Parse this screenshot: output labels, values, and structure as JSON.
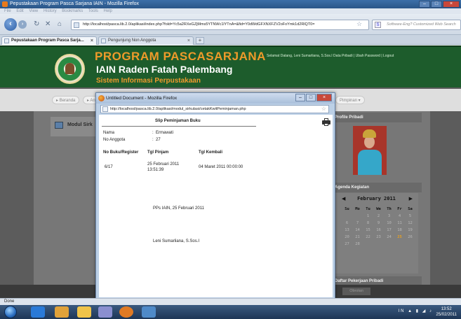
{
  "browser": {
    "window_title": "Pepustakaan Program Pasca Sarjana IAIN - Mozilla Firefox",
    "menu": [
      "File",
      "Edit",
      "View",
      "History",
      "Bookmarks",
      "Tools",
      "Help"
    ],
    "url": "http://localhost/pasca.lib.2.0/aplikasi/index.php?fold=Yc5a2RXeGZjMms5YTNWc1lYTnA=&fid=Y0dWdGFXNXFZV2oFoYmk1d2RlQT0=",
    "search_placeholder": "Software-Eng? Customized Web Search",
    "tabs": [
      {
        "label": "Pepustakaan Program Pasca Sarja..."
      },
      {
        "label": "Pengunjung Non Anggota"
      }
    ],
    "status": "Done"
  },
  "site": {
    "title": "PROGRAM PASCASARJANA",
    "subtitle": "IAIN Raden Fatah Palembang",
    "tagline": "Sistem Informasi Perpustakaan",
    "welcome": "Selamat Datang, Leni Sumarliana, S.Sos.I   Data Pribadi | Ubah Password | Logout",
    "menu": {
      "home": "Beranda",
      "partial": "An",
      "leader": "Pimpinan"
    },
    "module_label": "Modul Sirk",
    "side_profile": "Profile Pribadi",
    "side_agenda": "Agenda Kegiatan",
    "side_tasks": "Daftar Pekerjaan Pribadi",
    "footer_btn": "Obrolan"
  },
  "calendar": {
    "title": "February 2011",
    "weekdays": [
      "Su",
      "Mo",
      "Tu",
      "We",
      "Th",
      "Fr",
      "Sa"
    ],
    "days": [
      "",
      "",
      "1",
      "2",
      "3",
      "4",
      "5",
      "6",
      "7",
      "8",
      "9",
      "10",
      "11",
      "12",
      "13",
      "14",
      "15",
      "16",
      "17",
      "18",
      "19",
      "20",
      "21",
      "22",
      "23",
      "24",
      "25",
      "26",
      "27",
      "28"
    ],
    "today": "25"
  },
  "popup": {
    "title": "Untitled Document - Mozilla Firefox",
    "url": "http://localhost/pasca.lib.2.0/aplikasi/modul_sirkulasi/cetakKwitPeminjaman.php",
    "slip_title": "Slip Peminjaman Buku",
    "nama_label": "Nama",
    "nama_value": "Ermawati",
    "anggota_label": "No Anggota",
    "anggota_value": "27",
    "colon": ":",
    "headers": {
      "reg": "No Buku/Register",
      "pinjam": "Tgl Pinjam",
      "kembali": "Tgl Kembali"
    },
    "row": {
      "reg": "6/17",
      "pinjam_date": "25 Februari 2011",
      "pinjam_time": "13:51:39",
      "kembali": "04 Maret 2011 00:00:00"
    },
    "place_date": "PPs IAIN, 25 Februari 2011",
    "signer": "Leni Sumarliana, S.Sos.I"
  },
  "taskbar": {
    "tray": "IN",
    "time": "13:52",
    "date": "25/02/2011"
  }
}
